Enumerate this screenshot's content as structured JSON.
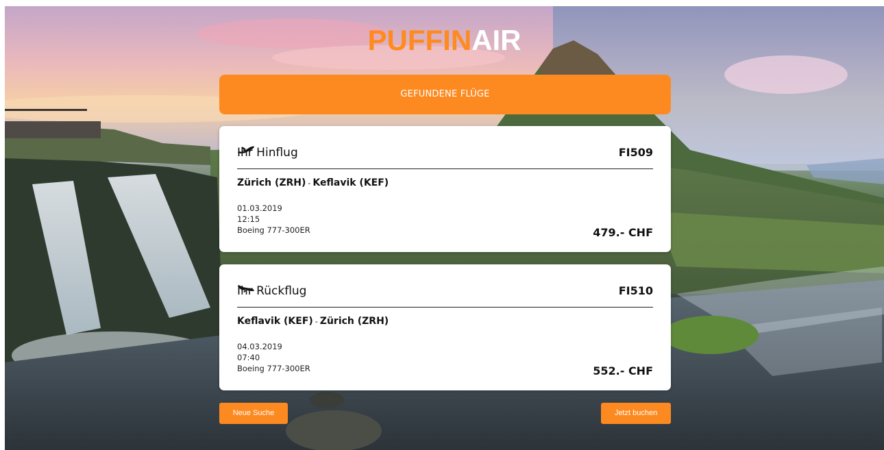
{
  "brand": {
    "part1": "PUFFIN",
    "part2": "AIR",
    "accent": "#fd8a21"
  },
  "banner": {
    "title": "GEFUNDENE FLÜGE"
  },
  "outbound": {
    "title": "Ihr Hinflug",
    "flight_no": "FI509",
    "from": "Zürich (ZRH)",
    "separator": "-",
    "to": "Keflavik (KEF)",
    "date": "01.03.2019",
    "time": "12:15",
    "aircraft": "Boeing 777-300ER",
    "price": "479.- CHF",
    "icon": "plane-takeoff-icon"
  },
  "return": {
    "title": "Ihr Rückflug",
    "flight_no": "FI510",
    "from": "Keflavik (KEF)",
    "separator": "-",
    "to": "Zürich (ZRH)",
    "date": "04.03.2019",
    "time": "07:40",
    "aircraft": "Boeing 777-300ER",
    "price": "552.- CHF",
    "icon": "plane-landing-icon"
  },
  "actions": {
    "new_search": "Neue Suche",
    "book_now": "Jetzt buchen"
  }
}
